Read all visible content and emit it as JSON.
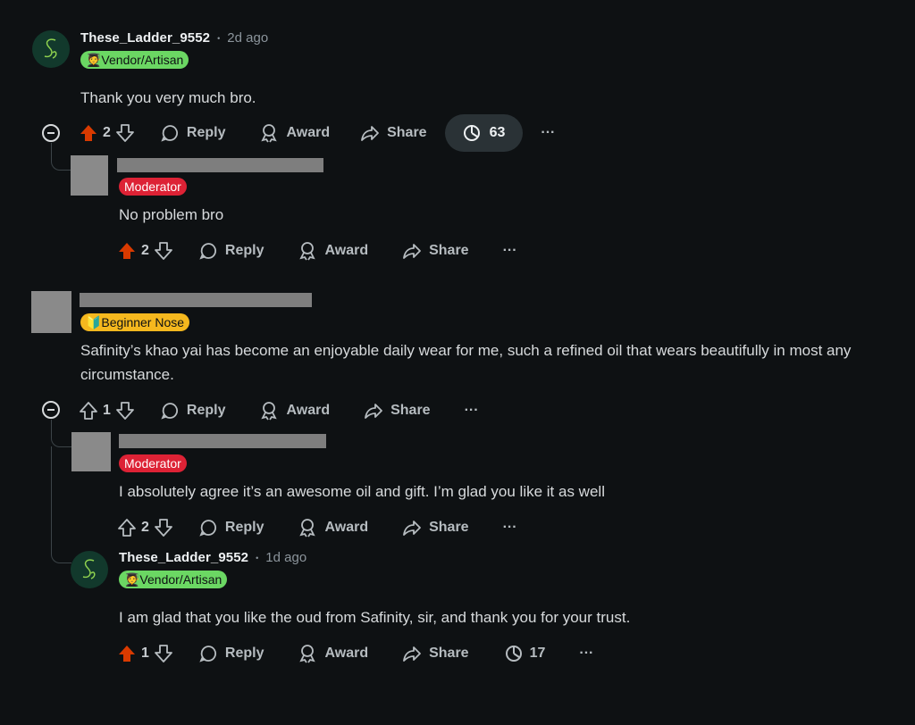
{
  "comments": [
    {
      "username": "These_Ladder_9552",
      "time": "2d ago",
      "flair": "🧑‍🎓Vendor/Artisan",
      "body": "Thank you very much bro.",
      "votes": "2",
      "reply": "Reply",
      "award": "Award",
      "share": "Share",
      "views": "63",
      "more": "···"
    },
    {
      "flair": "Moderator",
      "body": "No problem bro",
      "votes": "2",
      "reply": "Reply",
      "award": "Award",
      "share": "Share",
      "more": "···"
    },
    {
      "flair": "🔰Beginner Nose",
      "body": "Safinity’s khao yai has become an enjoyable daily wear for me, such a refined oil that wears beautifully in most any circumstance.",
      "votes": "1",
      "reply": "Reply",
      "award": "Award",
      "share": "Share",
      "more": "···"
    },
    {
      "flair": "Moderator",
      "body": "I absolutely agree it’s an awesome oil and gift. I’m glad you like it as well",
      "votes": "2",
      "reply": "Reply",
      "award": "Award",
      "share": "Share",
      "more": "···"
    },
    {
      "username": "These_Ladder_9552",
      "time": "1d ago",
      "flair": "🧑‍🎓Vendor/Artisan",
      "body": "I am glad that you like the oud from Safinity, sir, and thank you for your trust.",
      "votes": "1",
      "reply": "Reply",
      "award": "Award",
      "share": "Share",
      "views": "17",
      "more": "···"
    }
  ],
  "separator": "•",
  "colors": {
    "background": "#0e1113",
    "upvote_active": "#d93a00",
    "vendor_flair": "#6bd763",
    "moderator_flair": "#dd2235",
    "beginner_flair": "#f5b81e"
  },
  "icons": [
    "upvote-icon",
    "downvote-icon",
    "reply-bubble-icon",
    "award-ribbon-icon",
    "share-arrow-icon",
    "views-icon",
    "collapse-icon",
    "more-icon"
  ]
}
